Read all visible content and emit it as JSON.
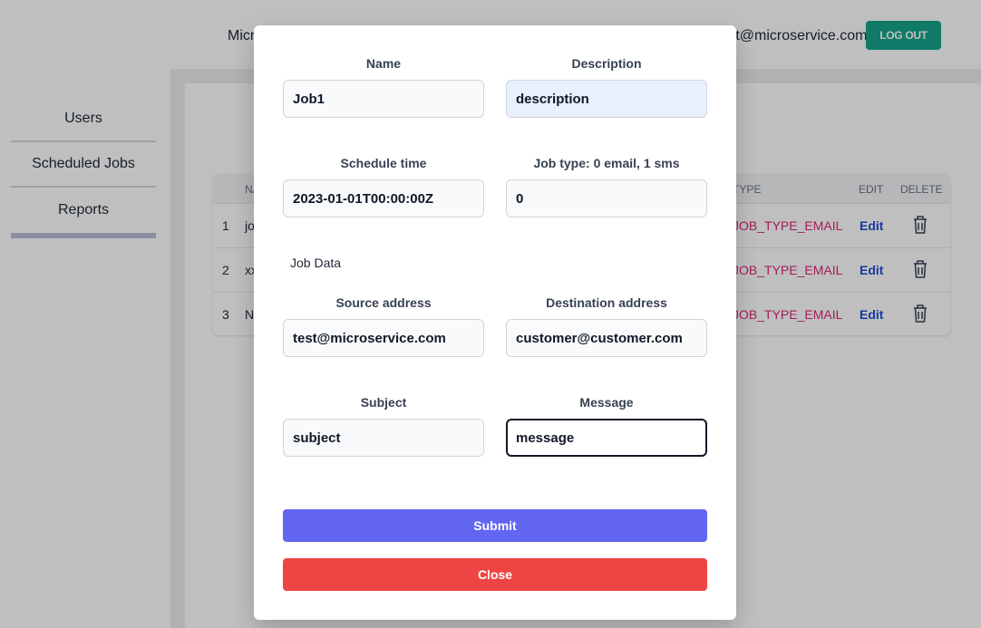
{
  "header": {
    "left_text": "Microservice Admin",
    "right_text": "test@microservice.com",
    "logout_label": "LOG OUT"
  },
  "sidebar": {
    "items": [
      {
        "label": "Users"
      },
      {
        "label": "Scheduled Jobs"
      },
      {
        "label": "Reports"
      }
    ]
  },
  "table": {
    "columns": {
      "num": "",
      "name": "NAME",
      "type": "TYPE",
      "edit": "EDIT",
      "delete": "DELETE"
    },
    "rows": [
      {
        "num": "1",
        "name": "job",
        "type": "JOB_TYPE_EMAIL",
        "edit": "Edit"
      },
      {
        "num": "2",
        "name": "xx",
        "type": "JOB_TYPE_EMAIL",
        "edit": "Edit"
      },
      {
        "num": "3",
        "name": "N",
        "type": "JOB_TYPE_EMAIL",
        "edit": "Edit"
      }
    ]
  },
  "modal": {
    "name": {
      "label": "Name",
      "value": "Job1"
    },
    "description": {
      "label": "Description",
      "value": "description"
    },
    "schedule_time": {
      "label": "Schedule time",
      "value": "2023-01-01T00:00:00Z"
    },
    "job_type": {
      "label": "Job type: 0 email, 1 sms",
      "value": "0"
    },
    "job_data_label": "Job Data",
    "source_address": {
      "label": "Source address",
      "value": "test@microservice.com"
    },
    "destination_address": {
      "label": "Destination address",
      "value": "customer@customer.com"
    },
    "subject": {
      "label": "Subject",
      "value": "subject"
    },
    "message": {
      "label": "Message",
      "value": "message"
    },
    "submit_label": "Submit",
    "close_label": "Close"
  },
  "colors": {
    "accent_teal": "#14a38b",
    "submit": "#6366f1",
    "close": "#ef4444",
    "type_text": "#db2777",
    "edit_link": "#1d4ed8"
  }
}
